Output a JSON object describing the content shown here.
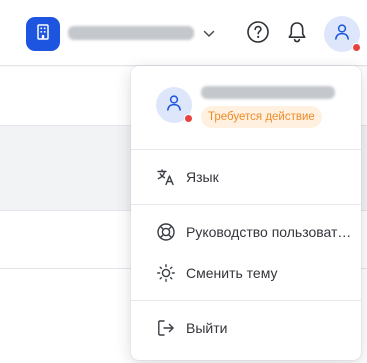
{
  "header": {
    "org_name": "",
    "avatar_status_color": "#e8423f",
    "icons": [
      "building-icon",
      "chevron-down-icon",
      "help-icon",
      "bell-icon",
      "user-icon"
    ]
  },
  "user_menu": {
    "user_name": "",
    "action_badge": "Требуется действие",
    "items": [
      {
        "id": "language",
        "label": "Язык",
        "icon": "translate-icon"
      },
      {
        "id": "guide",
        "label": "Руководство пользователя",
        "icon": "lifebuoy-icon"
      },
      {
        "id": "theme",
        "label": "Сменить тему",
        "icon": "sun-icon"
      },
      {
        "id": "logout",
        "label": "Выйти",
        "icon": "logout-icon"
      }
    ]
  },
  "colors": {
    "brand": "#1d55e0",
    "avatar_bg": "#dde6fb",
    "badge_bg": "#fff0e0",
    "badge_text": "#ee8c2a"
  }
}
